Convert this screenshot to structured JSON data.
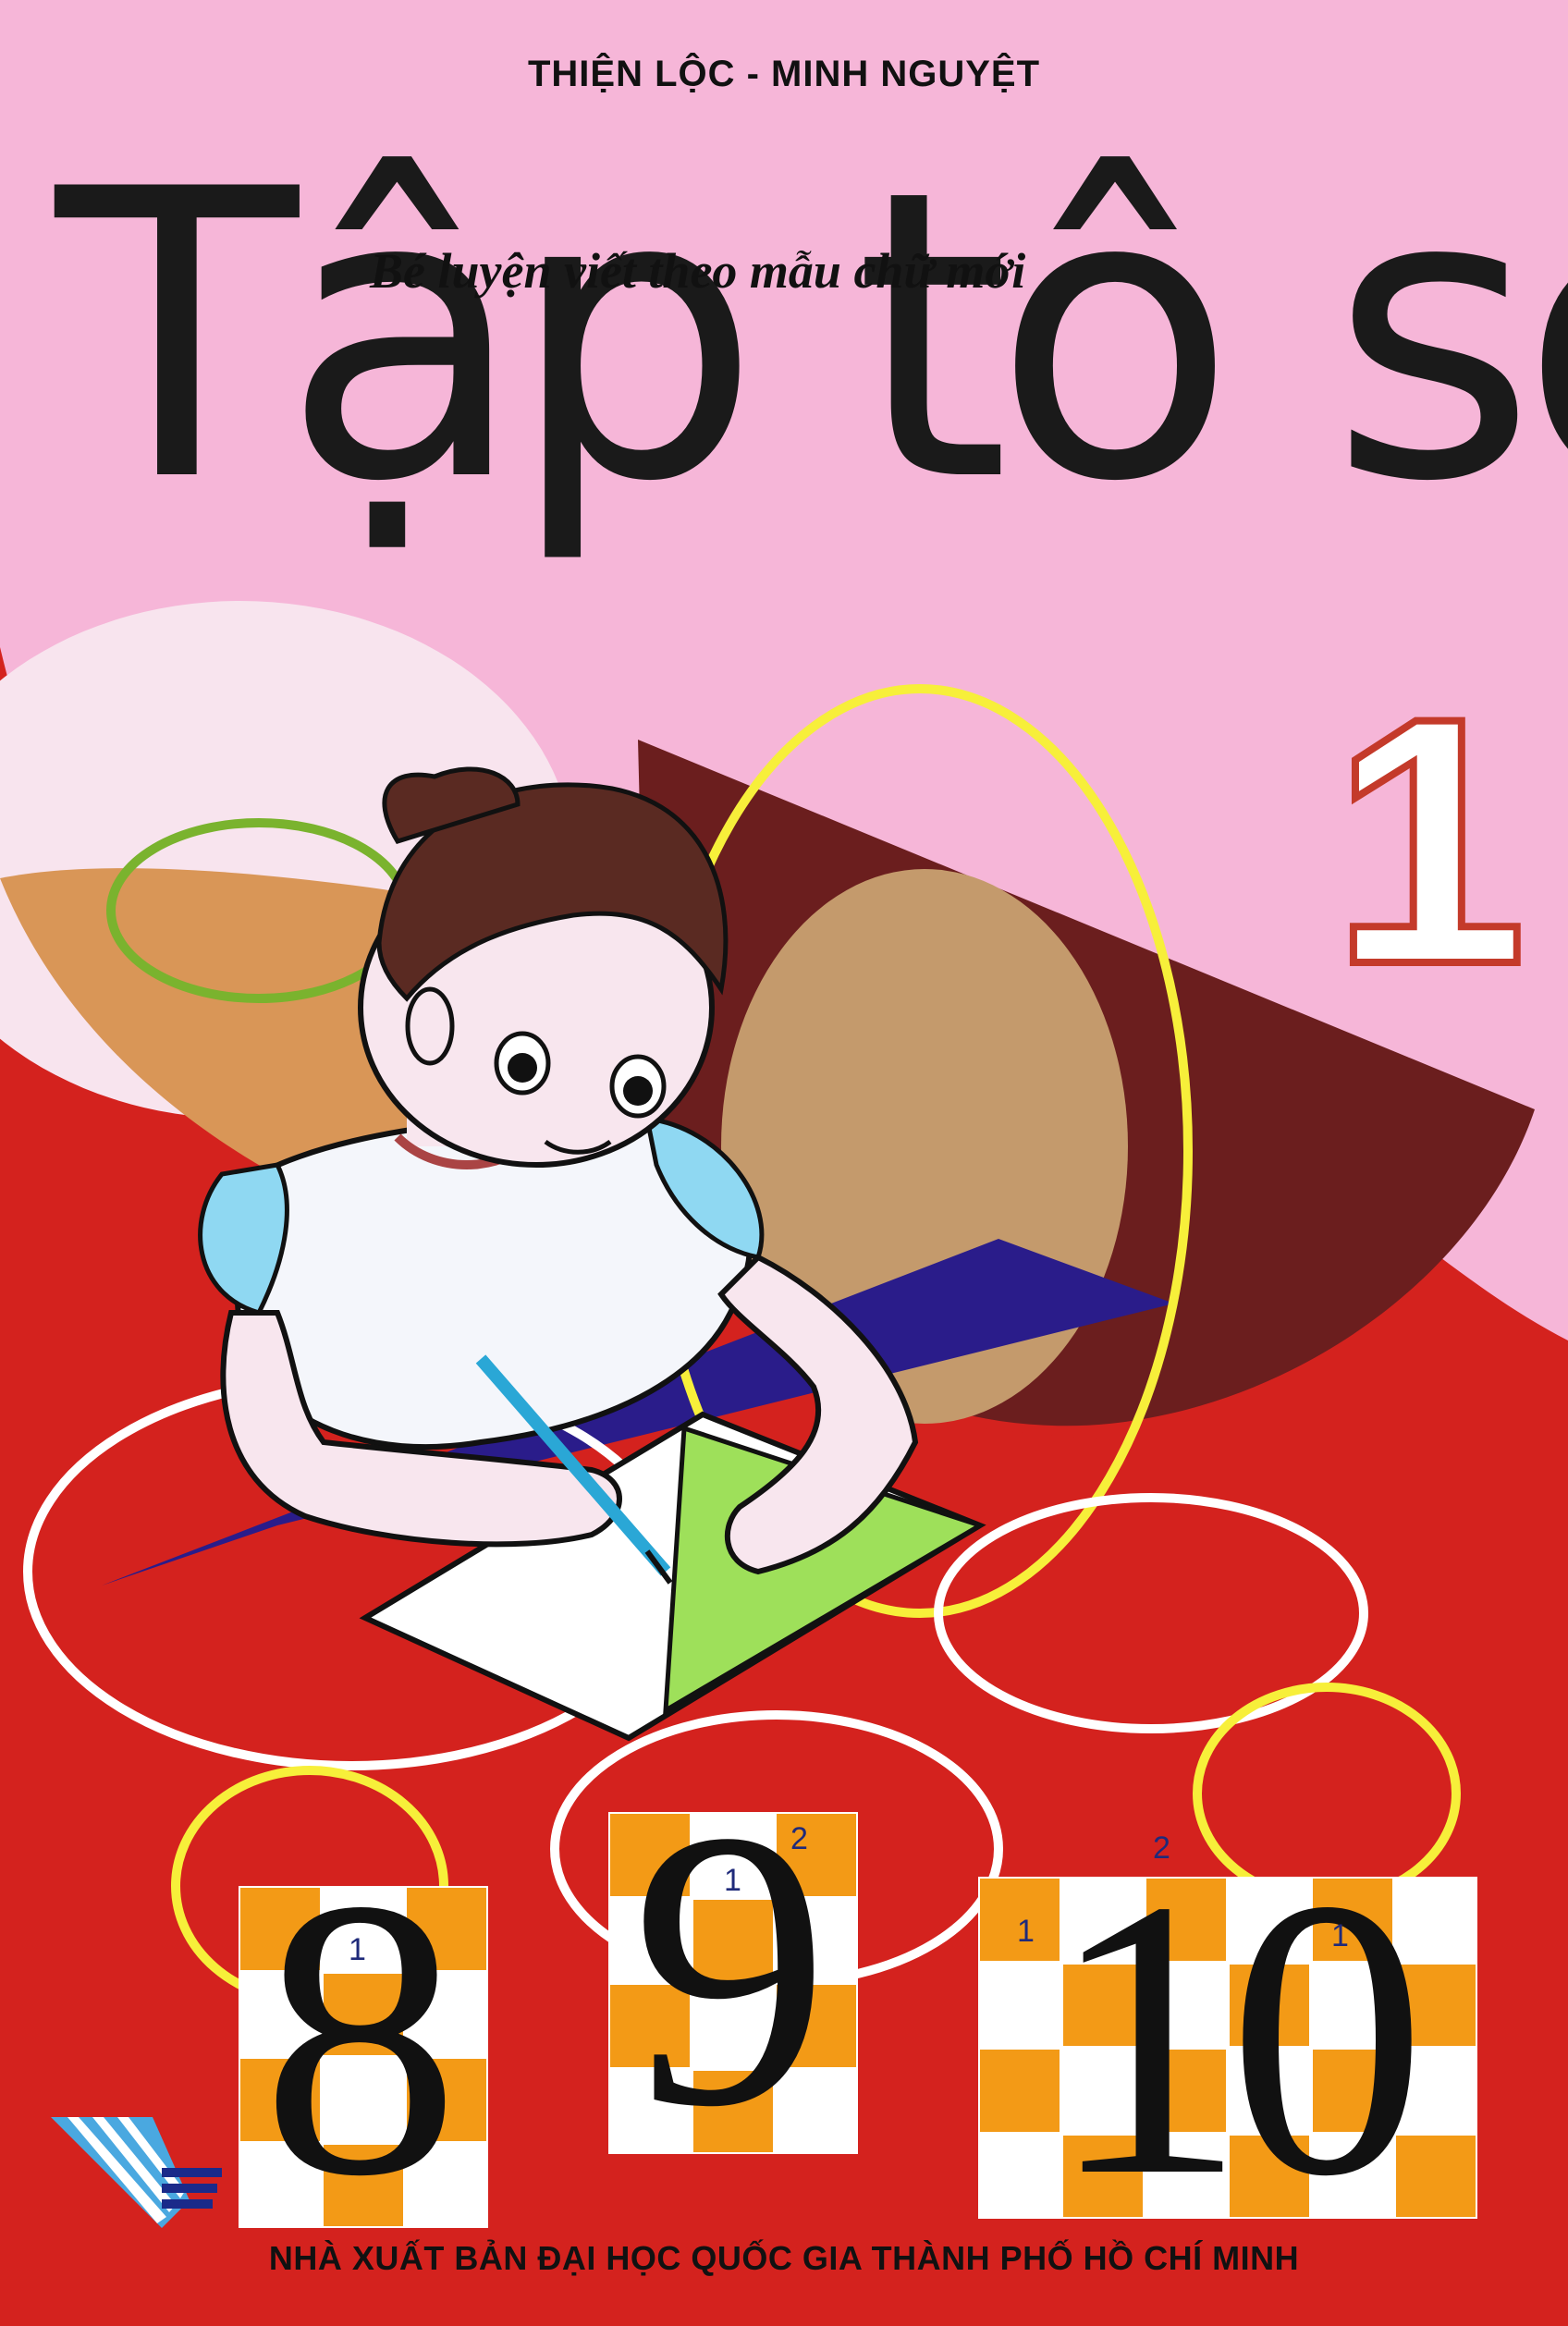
{
  "cover": {
    "authors": "THIỆN LỘC - MINH NGUYỆT",
    "subtitle": "Bé luyện viết theo mẫu chữ mới",
    "title": "Tập tô số",
    "volume": "1",
    "publisher": "NHÀ XUẤT BẢN ĐẠI HỌC QUỐC GIA THÀNH PHỐ HỒ CHÍ MINH"
  },
  "practice": {
    "numbers": [
      {
        "digit": "8",
        "stroke_labels": [
          "1"
        ]
      },
      {
        "digit": "9",
        "stroke_labels": [
          "1",
          "2"
        ]
      },
      {
        "digit": "10",
        "stroke_labels": [
          "1",
          "2",
          "1"
        ]
      }
    ]
  },
  "colors": {
    "background_pink": "#f6b6d8",
    "red": "#d4221e",
    "orange": "#f39a16",
    "brown": "#6b1e1e",
    "tan": "#c49a6c",
    "navy": "#2a1c8a",
    "yellow_ring": "#f7ef3a",
    "green_ring": "#7ab32e"
  },
  "illustration": {
    "subject": "girl-writing-in-notebook"
  }
}
